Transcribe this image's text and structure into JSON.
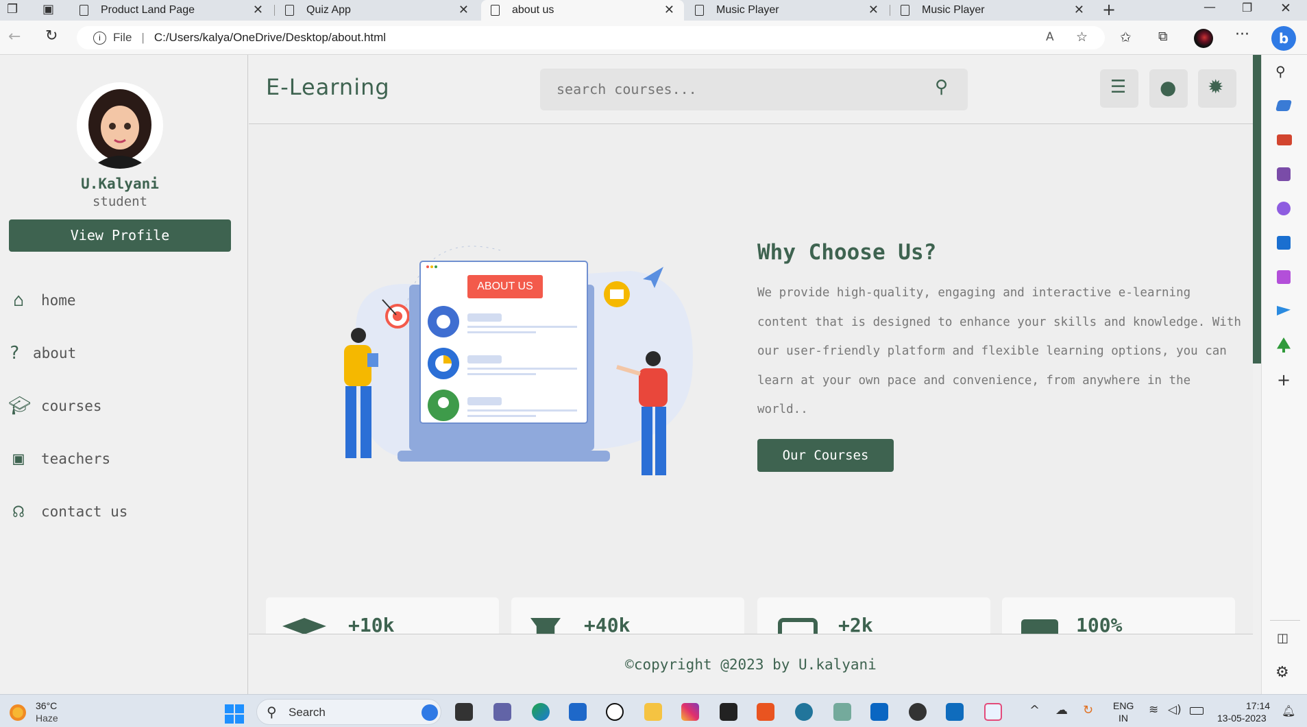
{
  "browser": {
    "tabs": [
      {
        "label": "Product Land Page"
      },
      {
        "label": "Quiz App"
      },
      {
        "label": "about us"
      },
      {
        "label": "Music Player"
      },
      {
        "label": "Music Player"
      }
    ],
    "address": {
      "prefix": "File",
      "url": "C:/Users/kalya/OneDrive/Desktop/about.html"
    }
  },
  "sidebar": {
    "name": "U.Kalyani",
    "role": "student",
    "view_profile": "View Profile",
    "nav": [
      {
        "label": "home",
        "icon": "home-icon"
      },
      {
        "label": "about",
        "icon": "question-icon"
      },
      {
        "label": "courses",
        "icon": "graduation-cap-icon"
      },
      {
        "label": "teachers",
        "icon": "chalkboard-teacher-icon"
      },
      {
        "label": "contact us",
        "icon": "headset-icon"
      }
    ]
  },
  "header": {
    "logo": "E-Learning",
    "search_placeholder": "search courses..."
  },
  "about": {
    "badge": "ABOUT US",
    "heading": "Why Choose Us?",
    "body": "We provide high-quality, engaging and interactive e-learning content that is designed to enhance your skills and knowledge. With our user-friendly platform and flexible learning options, you can learn at your own pace and convenience, from anywhere in the world..",
    "cta": "Our Courses"
  },
  "stats": [
    {
      "value": "+10k",
      "icon": "graduation-cap-icon"
    },
    {
      "value": "+40k",
      "icon": "user-graduate-icon"
    },
    {
      "value": "+2k",
      "icon": "chalkboard-teacher-icon"
    },
    {
      "value": "100%",
      "icon": "briefcase-icon"
    }
  ],
  "footer": {
    "text": "©copyright @2023 by U.kalyani"
  },
  "taskbar": {
    "weather_temp": "36°C",
    "weather_desc": "Haze",
    "search": "Search",
    "lang": "ENG",
    "region": "IN",
    "time": "17:14",
    "date": "13-05-2023"
  },
  "colors": {
    "accent": "#3e6350",
    "badge": "#f35a4b"
  }
}
